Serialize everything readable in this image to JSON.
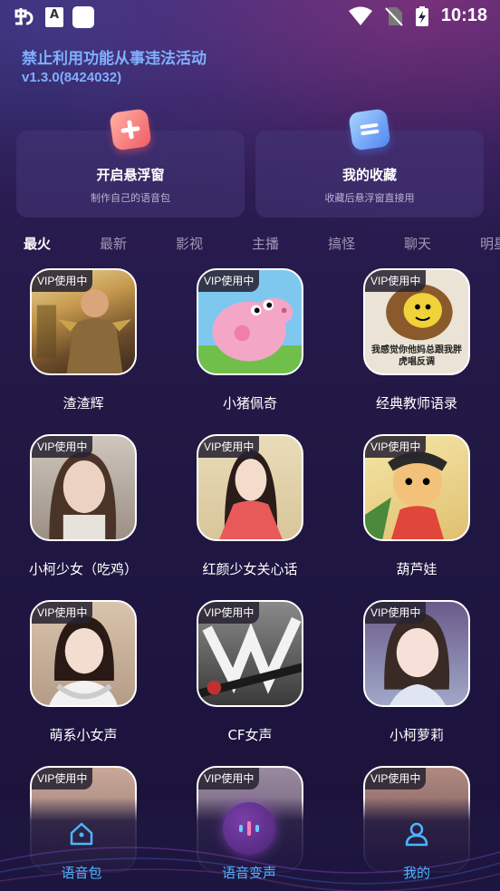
{
  "status_bar": {
    "time": "10:18",
    "a_icon": "A"
  },
  "header": {
    "notice": "禁止利用功能从事违法活动",
    "version": "v1.3.0(8424032)"
  },
  "cards": [
    {
      "title": "开启悬浮窗",
      "subtitle": "制作自己的语音包",
      "icon": "plus-icon"
    },
    {
      "title": "我的收藏",
      "subtitle": "收藏后悬浮窗直接用",
      "icon": "list-icon"
    }
  ],
  "tabs": [
    "最火",
    "最新",
    "影视",
    "主播",
    "搞怪",
    "聊天",
    "明星"
  ],
  "active_tab": "最火",
  "tiles": [
    {
      "label": "渣渣辉",
      "badge": "VIP使用中"
    },
    {
      "label": "小猪佩奇",
      "badge": "VIP使用中"
    },
    {
      "label": "经典教师语录",
      "badge": "VIP使用中",
      "caption": "我感觉你他妈总跟我胖虎唱反调"
    },
    {
      "label": "小柯少女（吃鸡）",
      "badge": "VIP使用中"
    },
    {
      "label": "红颜少女关心话",
      "badge": "VIP使用中"
    },
    {
      "label": "葫芦娃",
      "badge": "VIP使用中"
    },
    {
      "label": "萌系小女声",
      "badge": "VIP使用中"
    },
    {
      "label": "CF女声",
      "badge": "VIP使用中"
    },
    {
      "label": "小柯萝莉",
      "badge": "VIP使用中"
    },
    {
      "label": "",
      "badge": "VIP使用中"
    },
    {
      "label": "",
      "badge": "VIP使用中"
    },
    {
      "label": "",
      "badge": "VIP使用中"
    }
  ],
  "bottom_nav": {
    "left": "语音包",
    "center": "语音变声",
    "right": "我的"
  },
  "colors": {
    "accent": "#4bb6ff",
    "header_text": "#7fb0ff",
    "bg": "#221845"
  }
}
